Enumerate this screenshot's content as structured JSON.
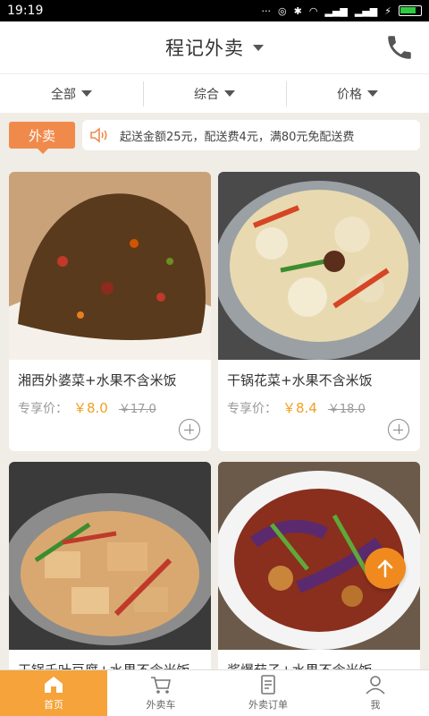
{
  "status": {
    "time": "19:19"
  },
  "header": {
    "title": "程记外卖"
  },
  "filters": [
    {
      "label": "全部"
    },
    {
      "label": "综合"
    },
    {
      "label": "价格"
    }
  ],
  "notice": {
    "tag": "外卖",
    "text": "起送金额25元，配送费4元，满80元免配送费"
  },
  "products": [
    {
      "name": "湘西外婆菜+水果不含米饭",
      "price_label": "专享价：",
      "price": "￥8.0",
      "old_price": "￥17.0"
    },
    {
      "name": "干锅花菜+水果不含米饭",
      "price_label": "专享价：",
      "price": "￥8.4",
      "old_price": "￥18.0"
    },
    {
      "name": "干锅千叶豆腐+水果不含米饭"
    },
    {
      "name": "酱爆茄子+水果不含米饭"
    }
  ],
  "tabs": [
    {
      "label": "首页"
    },
    {
      "label": "外卖车"
    },
    {
      "label": "外卖订单"
    },
    {
      "label": "我"
    }
  ],
  "colors": {
    "accent": "#f08a4b",
    "price": "#f0a020",
    "tab_active": "#f5a33a",
    "fab": "#f08a1e"
  }
}
